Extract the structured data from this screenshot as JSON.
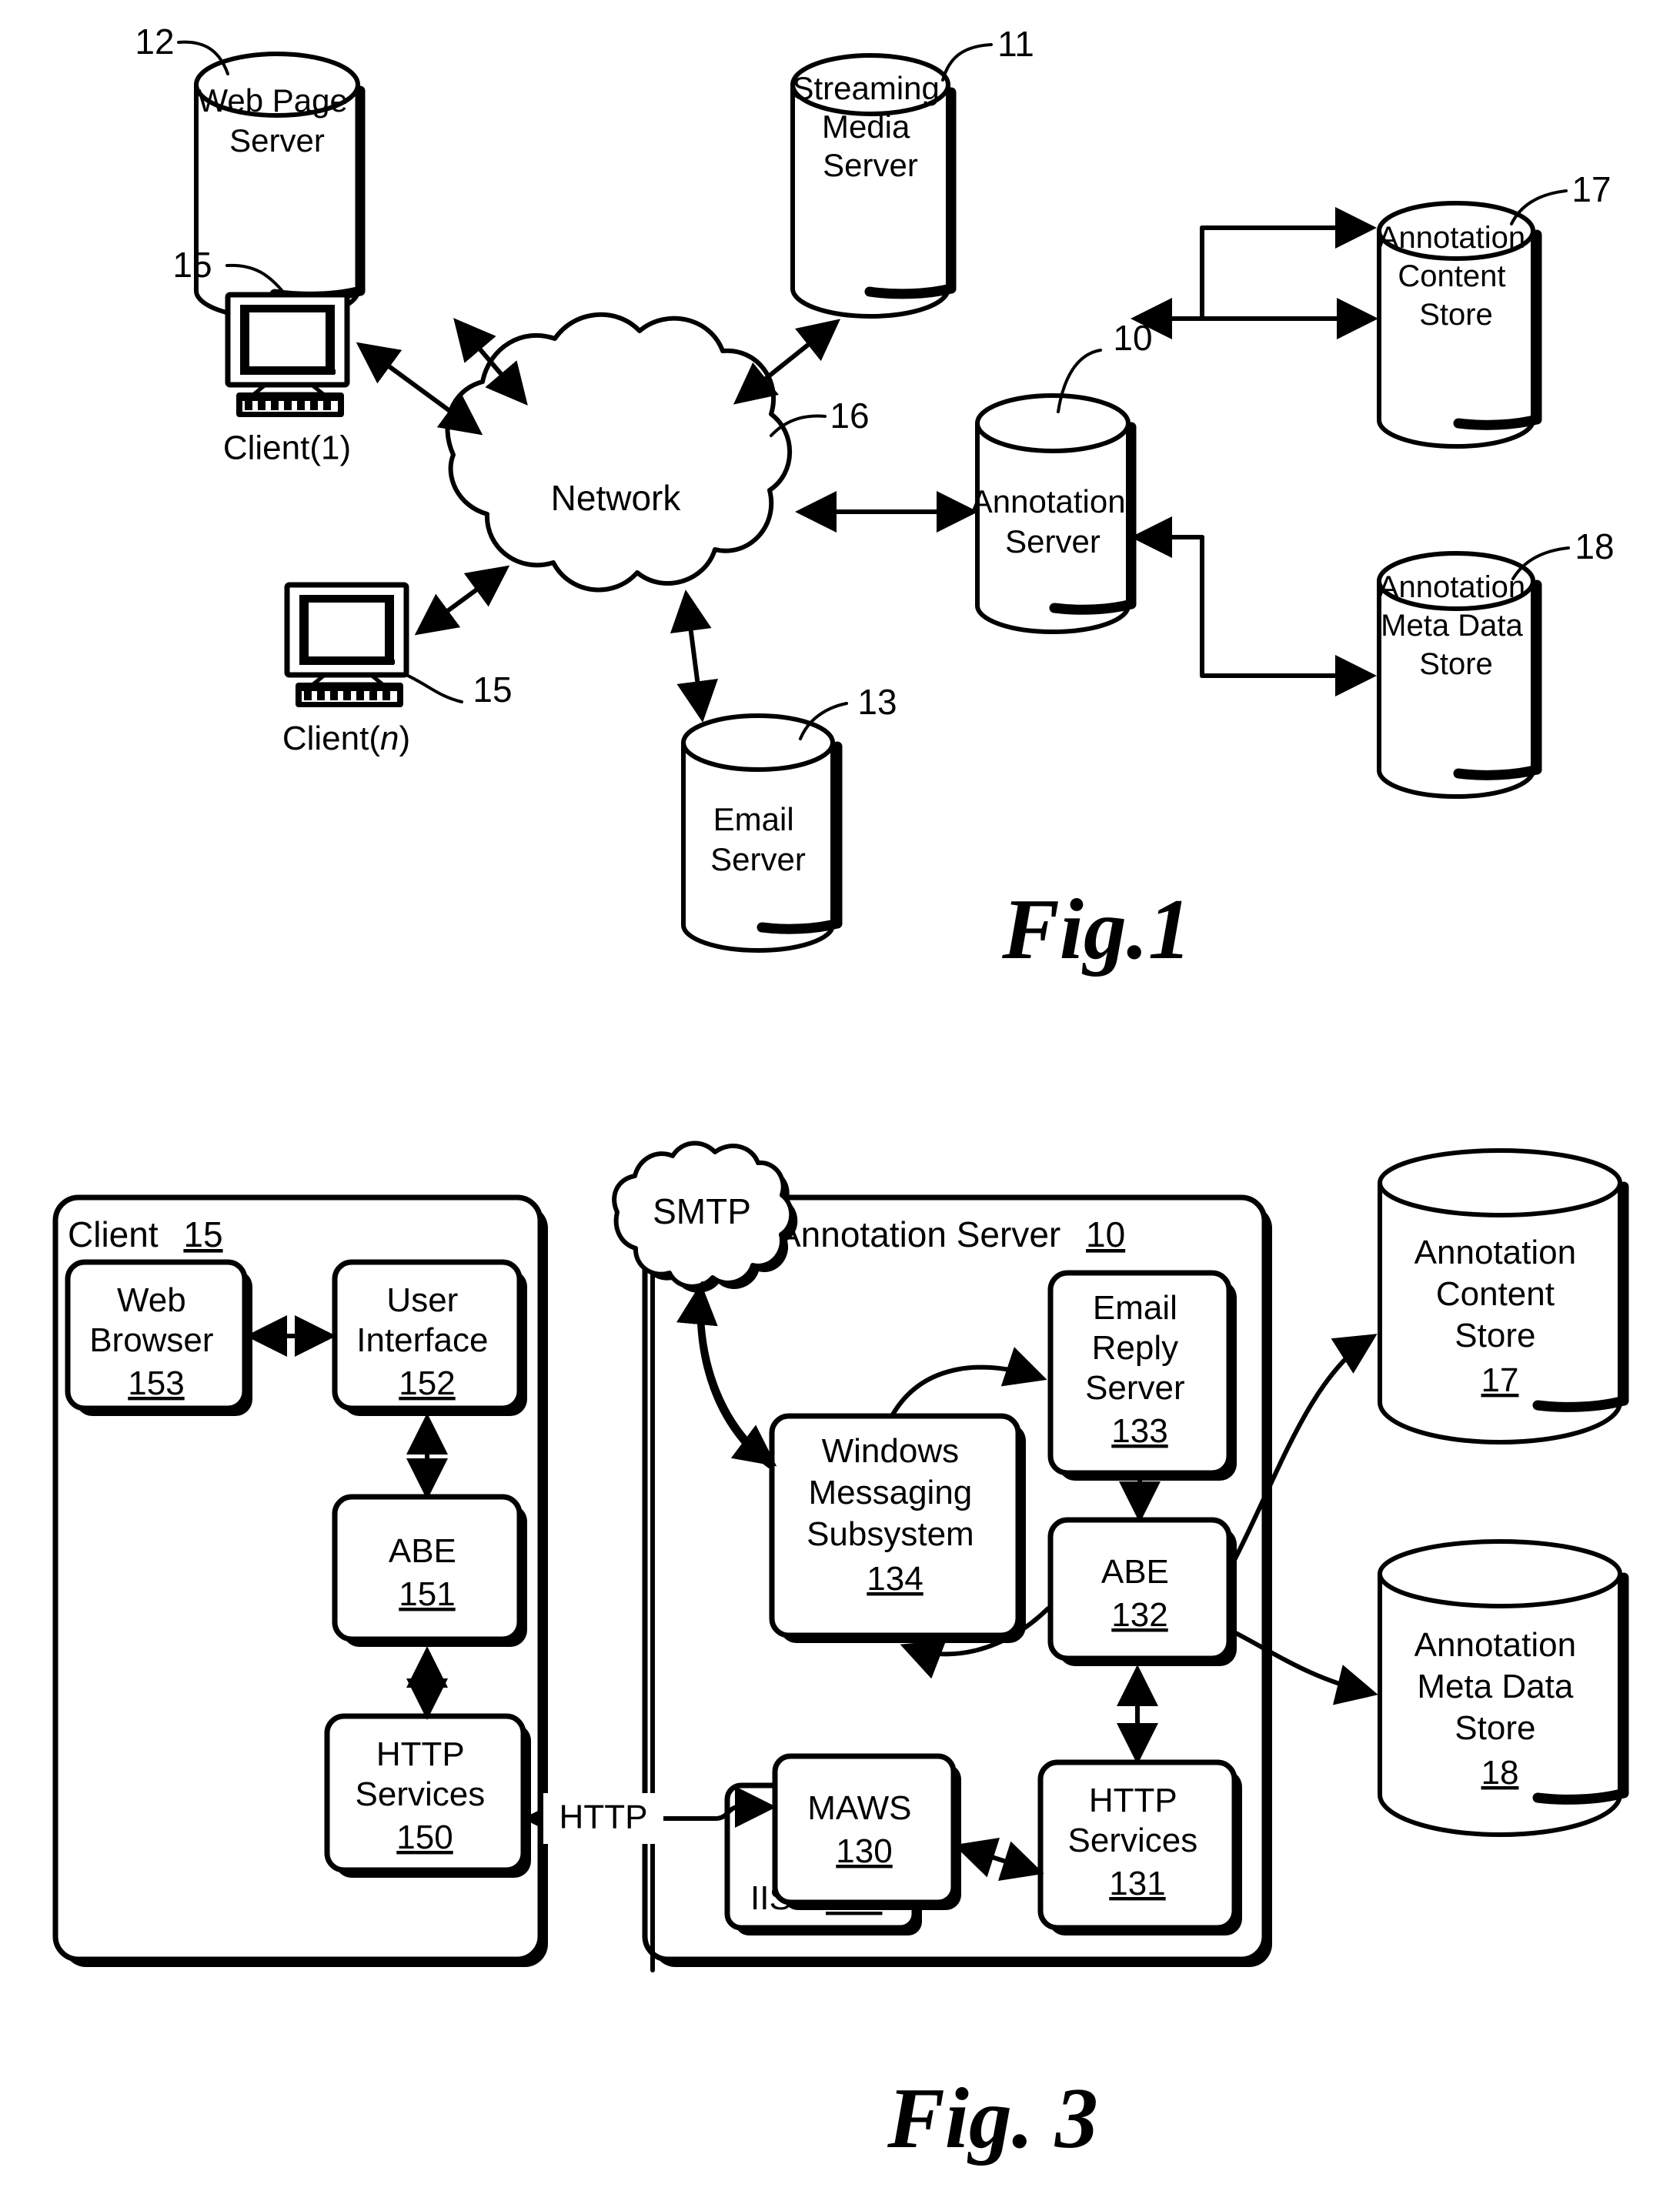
{
  "figure1": {
    "caption": "Fig.1",
    "nodes": [
      {
        "id": "web-page-server",
        "label_lines": [
          "Web Page",
          "Server"
        ],
        "ref": "12",
        "shape": "cylinder"
      },
      {
        "id": "streaming-media-server",
        "label_lines": [
          "Streaming",
          "Media",
          "Server"
        ],
        "ref": "11",
        "shape": "cylinder"
      },
      {
        "id": "annotation-content-store",
        "label_lines": [
          "Annotation",
          "Content",
          "Store"
        ],
        "ref": "17",
        "shape": "cylinder"
      },
      {
        "id": "annotation-server",
        "label_lines": [
          "Annotation",
          "Server"
        ],
        "ref": "10",
        "shape": "cylinder"
      },
      {
        "id": "annotation-meta-data-store",
        "label_lines": [
          "Annotation",
          "Meta Data",
          "Store"
        ],
        "ref": "18",
        "shape": "cylinder"
      },
      {
        "id": "email-server",
        "label_lines": [
          "Email",
          "Server"
        ],
        "ref": "13",
        "shape": "cylinder"
      },
      {
        "id": "network",
        "label_lines": [
          "Network"
        ],
        "ref": "16",
        "shape": "cloud"
      },
      {
        "id": "client-1",
        "label_lines": [
          "Client(1)"
        ],
        "ref": "15",
        "shape": "computer"
      },
      {
        "id": "client-n",
        "label_lines": [
          "Client(n)"
        ],
        "ref": "15",
        "shape": "computer"
      }
    ],
    "client1_caption": "Client(1)",
    "clientn_caption_prefix": "Client(",
    "clientn_caption_italic": "n",
    "clientn_caption_suffix": ")",
    "network_label": "Network"
  },
  "figure3": {
    "caption": "Fig. 3",
    "client_container": {
      "title_text": "Client",
      "title_ref": "15",
      "boxes": [
        {
          "id": "web-browser",
          "label_lines": [
            "Web",
            "Browser"
          ],
          "ref": "153"
        },
        {
          "id": "user-interface",
          "label_lines": [
            "User",
            "Interface"
          ],
          "ref": "152"
        },
        {
          "id": "abe-client",
          "label_lines": [
            "ABE"
          ],
          "ref": "151"
        },
        {
          "id": "http-services-client",
          "label_lines": [
            "HTTP",
            "Services"
          ],
          "ref": "150"
        }
      ]
    },
    "server_container": {
      "title_text": "Annotation Server",
      "title_ref": "10",
      "boxes": [
        {
          "id": "email-reply-server",
          "label_lines": [
            "Email",
            "Reply",
            "Server"
          ],
          "ref": "133"
        },
        {
          "id": "windows-messaging-subsystem",
          "label_lines": [
            "Windows",
            "Messaging",
            "Subsystem"
          ],
          "ref": "134"
        },
        {
          "id": "abe-server",
          "label_lines": [
            "ABE"
          ],
          "ref": "132"
        },
        {
          "id": "maws",
          "label_lines": [
            "MAWS"
          ],
          "ref": "130"
        },
        {
          "id": "iis",
          "label_lines": [
            "IIS"
          ],
          "ref": "135"
        },
        {
          "id": "http-services-server",
          "label_lines": [
            "HTTP",
            "Services"
          ],
          "ref": "131"
        }
      ]
    },
    "smtp_cloud_label": "SMTP",
    "http_link_label": "HTTP",
    "stores": [
      {
        "id": "annotation-content-store-3",
        "label_lines": [
          "Annotation",
          "Content",
          "Store"
        ],
        "ref": "17"
      },
      {
        "id": "annotation-meta-data-store-3",
        "label_lines": [
          "Annotation",
          "Meta Data",
          "Store"
        ],
        "ref": "18"
      }
    ]
  },
  "colors": {
    "ink": "#000000",
    "paper": "#ffffff"
  }
}
